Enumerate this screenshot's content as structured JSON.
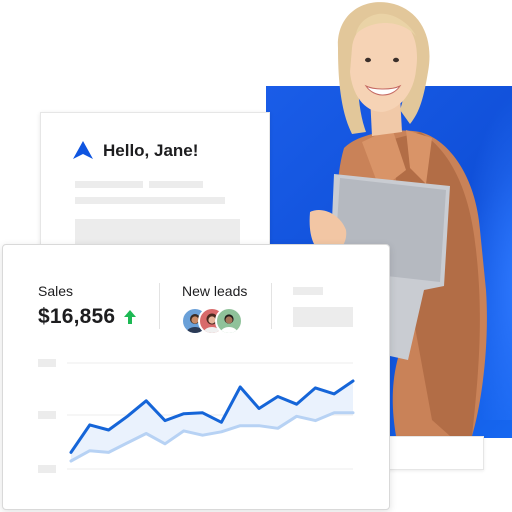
{
  "greeting_card": {
    "greeting": "Hello, Jane!"
  },
  "dashboard": {
    "sales_label": "Sales",
    "sales_value": "$16,856",
    "leads_label": "New leads",
    "avatar_count": 3
  },
  "colors": {
    "brand_blue": "#0f55e0",
    "line_primary": "#1565d8",
    "line_secondary": "#b7d2f4",
    "area_fill": "#eaf2fd",
    "up_arrow": "#1db954",
    "avatar_1": "#6aa0d8",
    "avatar_2": "#d86a6a",
    "avatar_3": "#8fc29a"
  },
  "icons": {
    "logo": "triangle-logo-icon",
    "trend": "up-arrow-icon"
  },
  "chart_data": {
    "type": "line",
    "x": [
      1,
      2,
      3,
      4,
      5,
      6,
      7,
      8,
      9,
      10,
      11,
      12,
      13,
      14,
      15,
      16
    ],
    "ylim": [
      0,
      100
    ],
    "series": [
      {
        "values": [
          10,
          42,
          36,
          52,
          70,
          47,
          55,
          56,
          45,
          86,
          61,
          75,
          66,
          85,
          78,
          93
        ]
      },
      {
        "values": [
          0,
          12,
          10,
          21,
          32,
          20,
          35,
          30,
          34,
          41,
          41,
          38,
          52,
          47,
          56,
          56
        ]
      }
    ]
  }
}
